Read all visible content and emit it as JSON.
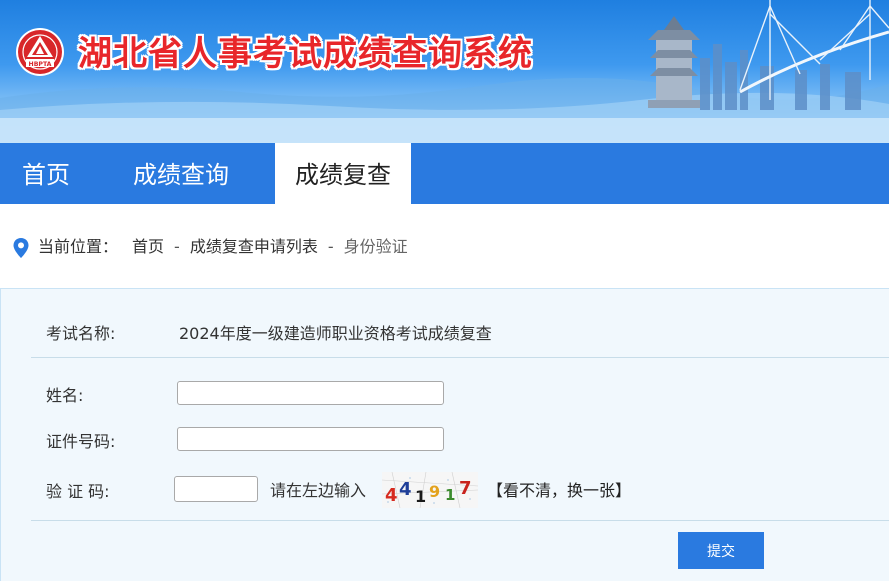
{
  "header": {
    "logo_text": "HBPTA",
    "title": "湖北省人事考试成绩查询系统"
  },
  "nav": {
    "items": [
      {
        "label": "首页"
      },
      {
        "label": "成绩查询"
      },
      {
        "label": "成绩复查",
        "active": true
      }
    ]
  },
  "breadcrumb": {
    "label": "当前位置：",
    "items": [
      "首页",
      "成绩复查申请列表",
      "身份验证"
    ],
    "separator": "-"
  },
  "form": {
    "exam_label": "考试名称:",
    "exam_name": "2024年度一级建造师职业资格考试成绩复查",
    "name_label": "姓名:",
    "name_value": "",
    "id_label": "证件号码:",
    "id_value": "",
    "captcha_label": "验 证 码:",
    "captcha_value": "",
    "captcha_hint": "请在左边输入",
    "captcha_code": "441917",
    "refresh_label": "【看不清，换一张】",
    "submit_label": "提交"
  },
  "colors": {
    "nav_bg": "#2a7ae0",
    "title_red": "#e8262a",
    "panel_bg": "#f1f8fd",
    "submit_bg": "#2a7ae0"
  }
}
